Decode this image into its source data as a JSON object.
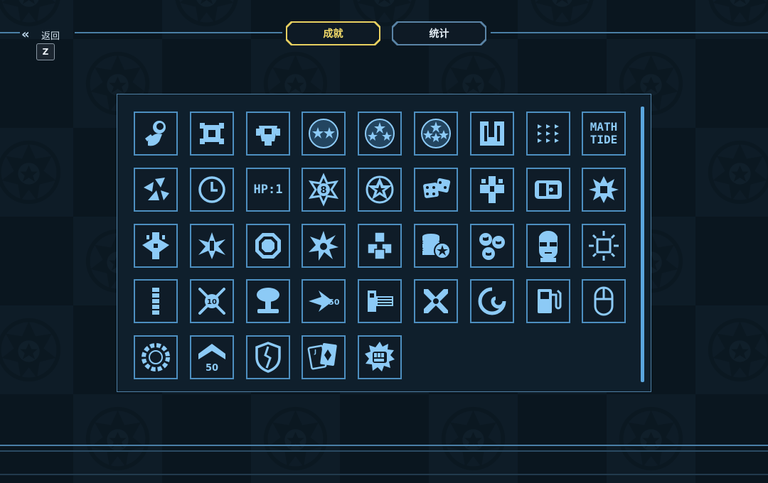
{
  "header": {
    "back_label": "返回",
    "back_key": "Z",
    "tabs": [
      {
        "label": "成就",
        "active": true
      },
      {
        "label": "统计",
        "active": false
      }
    ]
  },
  "colors": {
    "accent_active": "#e8d060",
    "icon_fill": "#8ccaf6",
    "icon_border": "#4d8fc0",
    "panel_border": "#4e7fa4"
  },
  "achievements": [
    {
      "icon": "astronaut-icon"
    },
    {
      "icon": "spaceship-top-icon"
    },
    {
      "icon": "spaceship-side-icon"
    },
    {
      "icon": "two-stars-icon"
    },
    {
      "icon": "three-stars-icon"
    },
    {
      "icon": "four-stars-icon"
    },
    {
      "icon": "split-panel-icon"
    },
    {
      "icon": "arrows-grid-icon"
    },
    {
      "icon": "text-icon",
      "text_lines": [
        "MATH",
        "TIDE"
      ]
    },
    {
      "icon": "shards-icon"
    },
    {
      "icon": "clock-icon"
    },
    {
      "icon": "text-icon",
      "text_lines": [
        "HP:1"
      ]
    },
    {
      "icon": "sheriff-badge-8-icon"
    },
    {
      "icon": "sheriff-badge-star-icon"
    },
    {
      "icon": "dice-icon"
    },
    {
      "icon": "mech-icon"
    },
    {
      "icon": "truck-icon"
    },
    {
      "icon": "spiky-ship-icon"
    },
    {
      "icon": "battle-ship-icon"
    },
    {
      "icon": "fighter-ship-icon"
    },
    {
      "icon": "octagon-ship-icon"
    },
    {
      "icon": "explosion-icon"
    },
    {
      "icon": "cubes-icon"
    },
    {
      "icon": "coins-star-icon"
    },
    {
      "icon": "globes-icon"
    },
    {
      "icon": "sunglasses-guy-icon"
    },
    {
      "icon": "sun-chip-icon"
    },
    {
      "icon": "stack-bar-icon"
    },
    {
      "icon": "crossed-swords-10-icon",
      "badge": "10"
    },
    {
      "icon": "mushroom-cloud-icon"
    },
    {
      "icon": "speed-150-icon",
      "badge": "150"
    },
    {
      "icon": "minigun-icon"
    },
    {
      "icon": "x-blades-icon"
    },
    {
      "icon": "swirl-icon"
    },
    {
      "icon": "fuel-pump-icon"
    },
    {
      "icon": "mouse-icon"
    },
    {
      "icon": "saw-ring-icon"
    },
    {
      "icon": "chevron-50-icon",
      "badge": "50"
    },
    {
      "icon": "broken-shield-icon"
    },
    {
      "icon": "playing-cards-icon",
      "badge": "J"
    },
    {
      "icon": "punch-icon"
    }
  ]
}
